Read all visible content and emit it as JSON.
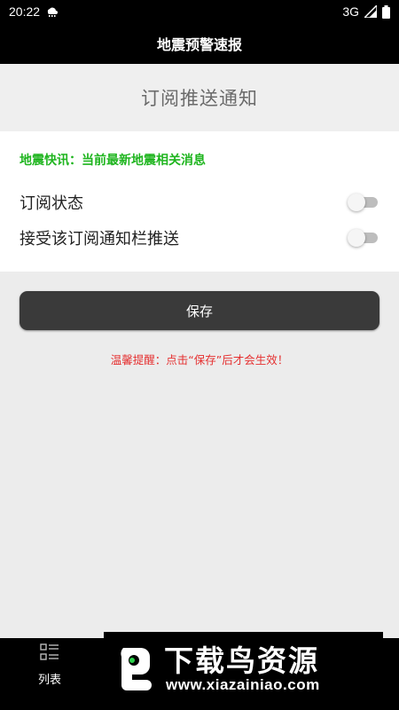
{
  "status_bar": {
    "time": "20:22",
    "network": "3G",
    "icons": [
      "cloud-icon",
      "signal-icon",
      "battery-icon"
    ]
  },
  "header": {
    "title": "地震预警速报"
  },
  "page": {
    "title": "订阅推送通知"
  },
  "card": {
    "headline": "地震快讯：当前最新地震相关消息",
    "settings": [
      {
        "label": "订阅状态",
        "enabled": false
      },
      {
        "label": "接受该订阅通知栏推送",
        "enabled": false
      }
    ]
  },
  "save_label": "保存",
  "reminder": "温馨提醒：点击“保存”后才会生效！",
  "bottom_nav": {
    "items": [
      {
        "label": "列表",
        "icon": "list-icon"
      }
    ]
  },
  "watermark": {
    "title": "下载鸟资源",
    "url": "www.xiazainiao.com"
  },
  "colors": {
    "header_bg": "#000000",
    "headline": "#1fb51f",
    "button_bg": "#3a3a3a",
    "reminder": "#e53030",
    "background": "#ececec"
  }
}
